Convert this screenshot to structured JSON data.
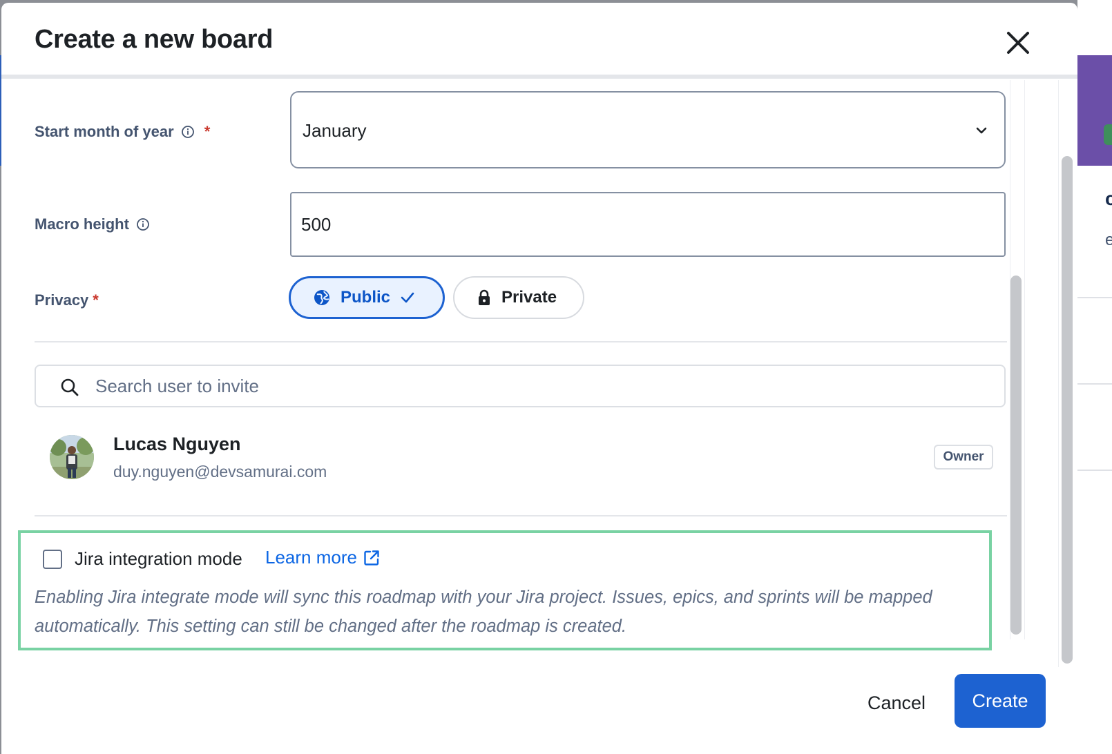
{
  "dialog": {
    "title": "Create a new board"
  },
  "form": {
    "start_month": {
      "label": "Start month of year",
      "required_mark": "*",
      "value": "January"
    },
    "macro_height": {
      "label": "Macro height",
      "value": "500"
    },
    "privacy": {
      "label": "Privacy",
      "required_mark": "*",
      "options": [
        {
          "label": "Public",
          "selected": true,
          "icon": "globe-icon"
        },
        {
          "label": "Private",
          "selected": false,
          "icon": "lock-icon"
        }
      ]
    }
  },
  "invite": {
    "search_placeholder": "Search user to invite",
    "members": [
      {
        "name": "Lucas Nguyen",
        "email": "duy.nguyen@devsamurai.com",
        "role": "Owner"
      }
    ]
  },
  "jira": {
    "checkbox_label": "Jira integration mode",
    "checked": false,
    "learn_more": "Learn more",
    "description": "Enabling Jira integrate mode will sync this roadmap with your Jira project. Issues, epics, and sprints will be mapped automatically. This setting can still be changed after the roadmap is created."
  },
  "footer": {
    "cancel_label": "Cancel",
    "create_label": "Create"
  },
  "colors": {
    "primary": "#1d62d1",
    "link": "#0c66e4",
    "required": "#c9372c",
    "highlight_border": "#79d2a3"
  }
}
